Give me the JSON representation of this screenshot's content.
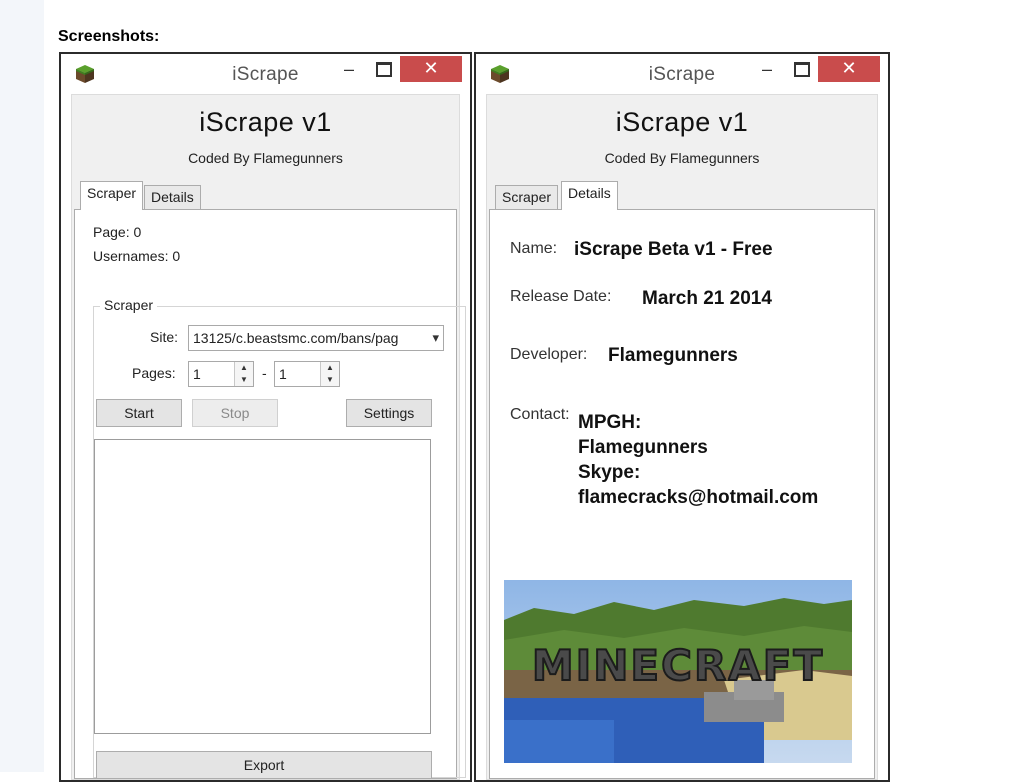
{
  "page": {
    "heading": "Screenshots:"
  },
  "windows": [
    {
      "title": "iScrape",
      "close_glyph": "✕",
      "min_glyph": "–",
      "app_title": "iScrape v1",
      "app_subtitle": "Coded By Flamegunners",
      "tabs": [
        "Scraper",
        "Details"
      ],
      "active_tab": "Scraper",
      "scraper": {
        "page_label": "Page: 0",
        "usernames_label": "Usernames: 0",
        "group_title": "Scraper",
        "site_label": "Site:",
        "site_value": "13125/c.beastsmc.com/bans/pag",
        "pages_label": "Pages:",
        "pages_from": "1",
        "pages_separator": "-",
        "pages_to": "1",
        "start_label": "Start",
        "stop_label": "Stop",
        "settings_label": "Settings",
        "export_label": "Export"
      }
    },
    {
      "title": "iScrape",
      "close_glyph": "✕",
      "min_glyph": "–",
      "app_title": "iScrape v1",
      "app_subtitle": "Coded By Flamegunners",
      "tabs": [
        "Scraper",
        "Details"
      ],
      "active_tab": "Details",
      "details": {
        "name_label": "Name:",
        "name_value": "iScrape Beta v1 - Free",
        "release_label": "Release Date:",
        "release_value": "March 21 2014",
        "developer_label": "Developer:",
        "developer_value": "Flamegunners",
        "contact_label": "Contact:",
        "contact_lines": [
          "MPGH:",
          "Flamegunners",
          "Skype:",
          "flamecracks@hotmail.com"
        ],
        "image_logo_text": "MINECRAFT"
      }
    }
  ],
  "colors": {
    "close_button": "#c94c4c",
    "window_border": "#2b2b2b",
    "client_bg": "#f0f0f0"
  },
  "icons": {
    "app_icon": "minecraft-grass-block-icon"
  }
}
